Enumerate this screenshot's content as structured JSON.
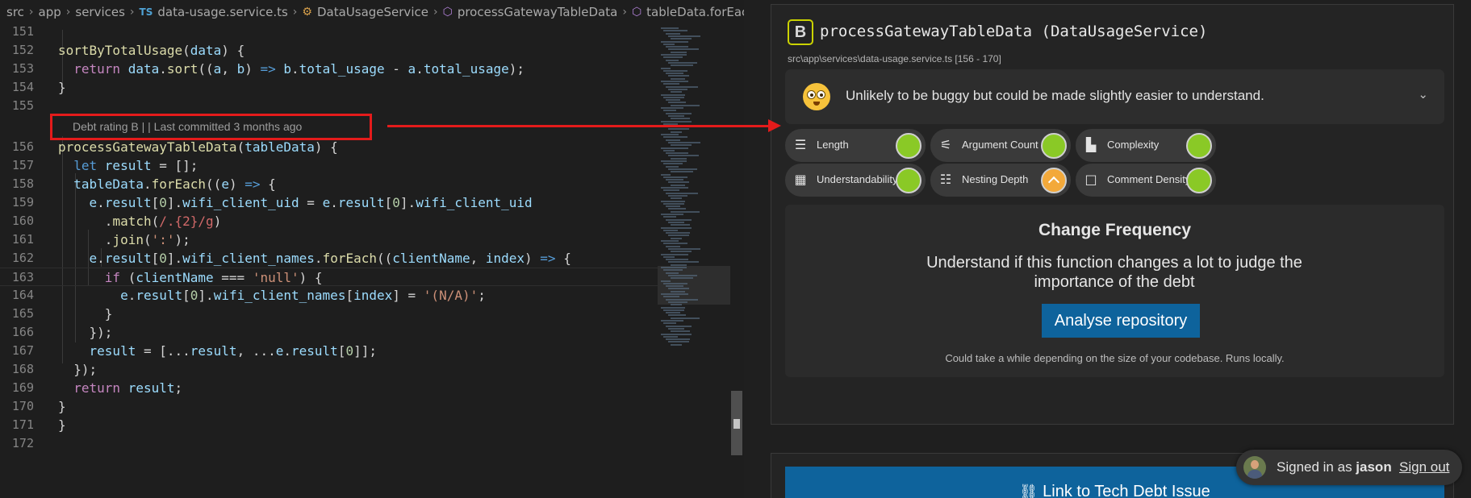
{
  "breadcrumb": {
    "items": [
      "src",
      "app",
      "services",
      "data-usage.service.ts",
      "DataUsageService",
      "processGatewayTableData",
      "tableData.forEach() ca"
    ],
    "ts_badge": "TS"
  },
  "code": {
    "lines": [
      {
        "n": "151",
        "segs": []
      },
      {
        "n": "152",
        "segs": [
          [
            "fn",
            "sortByTotalUsage"
          ],
          [
            "pl",
            "("
          ],
          [
            "var",
            "data"
          ],
          [
            "pl",
            ") {"
          ]
        ]
      },
      {
        "n": "153",
        "segs": [
          [
            "pl",
            "  "
          ],
          [
            "kw",
            "return "
          ],
          [
            "var",
            "data"
          ],
          [
            "pl",
            "."
          ],
          [
            "fn",
            "sort"
          ],
          [
            "pl",
            "(("
          ],
          [
            "var",
            "a"
          ],
          [
            "pl",
            ", "
          ],
          [
            "var",
            "b"
          ],
          [
            "pl",
            ") "
          ],
          [
            "kwb",
            "=>"
          ],
          [
            "pl",
            " "
          ],
          [
            "var",
            "b"
          ],
          [
            "pl",
            "."
          ],
          [
            "prop",
            "total_usage"
          ],
          [
            "pl",
            " - "
          ],
          [
            "var",
            "a"
          ],
          [
            "pl",
            "."
          ],
          [
            "prop",
            "total_usage"
          ],
          [
            "pl",
            ");"
          ]
        ]
      },
      {
        "n": "154",
        "segs": [
          [
            "pl",
            "}"
          ]
        ]
      },
      {
        "n": "155",
        "segs": []
      },
      {
        "n": "156",
        "segs": [
          [
            "fn",
            "processGatewayTableData"
          ],
          [
            "pl",
            "("
          ],
          [
            "var",
            "tableData"
          ],
          [
            "pl",
            ") {"
          ]
        ]
      },
      {
        "n": "157",
        "segs": [
          [
            "pl",
            "  "
          ],
          [
            "kwb",
            "let "
          ],
          [
            "var",
            "result"
          ],
          [
            "pl",
            " = [];"
          ]
        ]
      },
      {
        "n": "158",
        "segs": [
          [
            "pl",
            "  "
          ],
          [
            "var",
            "tableData"
          ],
          [
            "pl",
            "."
          ],
          [
            "fn",
            "forEach"
          ],
          [
            "pl",
            "(("
          ],
          [
            "var",
            "e"
          ],
          [
            "pl",
            ") "
          ],
          [
            "kwb",
            "=>"
          ],
          [
            "pl",
            " {"
          ]
        ]
      },
      {
        "n": "159",
        "segs": [
          [
            "pl",
            "    "
          ],
          [
            "var",
            "e"
          ],
          [
            "pl",
            "."
          ],
          [
            "prop",
            "result"
          ],
          [
            "pl",
            "["
          ],
          [
            "num",
            "0"
          ],
          [
            "pl",
            "]."
          ],
          [
            "prop",
            "wifi_client_uid"
          ],
          [
            "pl",
            " = "
          ],
          [
            "var",
            "e"
          ],
          [
            "pl",
            "."
          ],
          [
            "prop",
            "result"
          ],
          [
            "pl",
            "["
          ],
          [
            "num",
            "0"
          ],
          [
            "pl",
            "]."
          ],
          [
            "prop",
            "wifi_client_uid"
          ]
        ]
      },
      {
        "n": "160",
        "segs": [
          [
            "pl",
            "      ."
          ],
          [
            "fn",
            "match"
          ],
          [
            "pl",
            "("
          ],
          [
            "rx",
            "/.{2}/g"
          ],
          [
            "pl",
            ")"
          ]
        ]
      },
      {
        "n": "161",
        "segs": [
          [
            "pl",
            "      ."
          ],
          [
            "fn",
            "join"
          ],
          [
            "pl",
            "("
          ],
          [
            "str",
            "':'"
          ],
          [
            "pl",
            ");"
          ]
        ]
      },
      {
        "n": "162",
        "segs": [
          [
            "pl",
            "    "
          ],
          [
            "var",
            "e"
          ],
          [
            "pl",
            "."
          ],
          [
            "prop",
            "result"
          ],
          [
            "pl",
            "["
          ],
          [
            "num",
            "0"
          ],
          [
            "pl",
            "]."
          ],
          [
            "prop",
            "wifi_client_names"
          ],
          [
            "pl",
            "."
          ],
          [
            "fn",
            "forEach"
          ],
          [
            "pl",
            "(("
          ],
          [
            "var",
            "clientName"
          ],
          [
            "pl",
            ", "
          ],
          [
            "var",
            "index"
          ],
          [
            "pl",
            ") "
          ],
          [
            "kwb",
            "=>"
          ],
          [
            "pl",
            " {"
          ]
        ]
      },
      {
        "n": "163",
        "segs": [
          [
            "pl",
            "      "
          ],
          [
            "kw",
            "if"
          ],
          [
            "pl",
            " ("
          ],
          [
            "var",
            "clientName"
          ],
          [
            "pl",
            " === "
          ],
          [
            "str",
            "'null'"
          ],
          [
            "pl",
            ") {"
          ]
        ]
      },
      {
        "n": "164",
        "segs": [
          [
            "pl",
            "        "
          ],
          [
            "var",
            "e"
          ],
          [
            "pl",
            "."
          ],
          [
            "prop",
            "result"
          ],
          [
            "pl",
            "["
          ],
          [
            "num",
            "0"
          ],
          [
            "pl",
            "]."
          ],
          [
            "prop",
            "wifi_client_names"
          ],
          [
            "pl",
            "["
          ],
          [
            "var",
            "index"
          ],
          [
            "pl",
            "] = "
          ],
          [
            "str",
            "'(N/A)'"
          ],
          [
            "pl",
            ";"
          ]
        ]
      },
      {
        "n": "165",
        "segs": [
          [
            "pl",
            "      }"
          ]
        ]
      },
      {
        "n": "166",
        "segs": [
          [
            "pl",
            "    });"
          ]
        ]
      },
      {
        "n": "167",
        "segs": [
          [
            "pl",
            "    "
          ],
          [
            "var",
            "result"
          ],
          [
            "pl",
            " = [..."
          ],
          [
            "var",
            "result"
          ],
          [
            "pl",
            ", ..."
          ],
          [
            "var",
            "e"
          ],
          [
            "pl",
            "."
          ],
          [
            "prop",
            "result"
          ],
          [
            "pl",
            "["
          ],
          [
            "num",
            "0"
          ],
          [
            "pl",
            "]];"
          ]
        ]
      },
      {
        "n": "168",
        "segs": [
          [
            "pl",
            "  });"
          ]
        ]
      },
      {
        "n": "169",
        "segs": [
          [
            "pl",
            "  "
          ],
          [
            "kw",
            "return "
          ],
          [
            "var",
            "result"
          ],
          [
            "pl",
            ";"
          ]
        ]
      },
      {
        "n": "170",
        "segs": [
          [
            "pl",
            "}"
          ]
        ]
      },
      {
        "n": "171",
        "segs": [
          [
            "pl",
            "}"
          ]
        ]
      },
      {
        "n": "172",
        "segs": []
      }
    ],
    "codelens": "Debt rating B |  | Last committed 3 months ago"
  },
  "panel": {
    "rating": "B",
    "function_title": "processGatewayTableData (DataUsageService)",
    "function_path": "src\\app\\services\\data-usage.service.ts [156 - 170]",
    "summary": "Unlikely to be buggy but could be made slightly easier to understand.",
    "metrics": [
      {
        "label": "Length",
        "icon": "lines-icon",
        "glyph": "☰",
        "status": "good"
      },
      {
        "label": "Argument Count",
        "icon": "sliders-icon",
        "glyph": "⚟",
        "status": "good"
      },
      {
        "label": "Complexity",
        "icon": "bar-chart-icon",
        "glyph": "▙",
        "status": "good"
      },
      {
        "label": "Understandability",
        "icon": "book-icon",
        "glyph": "▦",
        "status": "good"
      },
      {
        "label": "Nesting Depth",
        "icon": "nested-list-icon",
        "glyph": "☷",
        "status": "warn"
      },
      {
        "label": "Comment Density",
        "icon": "comment-icon",
        "glyph": "□",
        "status": "good"
      }
    ],
    "change_frequency": {
      "title": "Change Frequency",
      "description": "Understand if this function changes a lot to judge the importance of the debt",
      "button": "Analyse repository",
      "note": "Could take a while depending on the size of your codebase. Runs locally."
    },
    "link_button": "Link to Tech Debt Issue",
    "signin": {
      "prefix": "Signed in as ",
      "user": "jason",
      "signout": "Sign out"
    }
  },
  "colors": {
    "accent": "#0e639c",
    "good": "#8ac926",
    "warn": "#f3a93a",
    "annotation": "#e41b1b",
    "rating_border": "#cbd300"
  }
}
